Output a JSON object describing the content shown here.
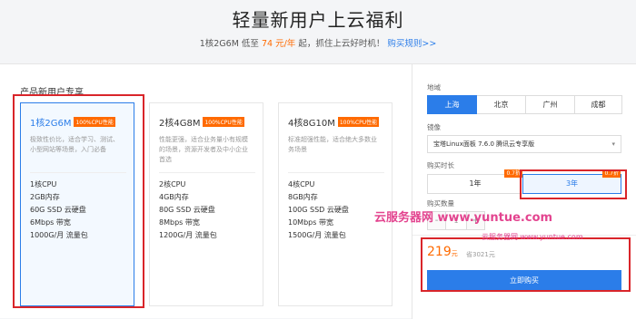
{
  "header": {
    "title": "轻量新用户上云福利",
    "sub_prefix": "1核2G6M 低至",
    "sub_price": "74 元/年",
    "sub_suffix": "起，抓住上云好时机！",
    "rules_link": "购买规则>>"
  },
  "products": {
    "section_title": "产品新用户专享",
    "cards": [
      {
        "name": "1核2G6M",
        "badge": "100%CPU性能",
        "desc": "极致性价比，适合学习、测试、小型网站等场景，入门必备",
        "specs": [
          "1核CPU",
          "2GB内存",
          "60G SSD 云硬盘",
          "6Mbps 带宽",
          "1000G/月 流量包"
        ]
      },
      {
        "name": "2核4G8M",
        "badge": "100%CPU性能",
        "desc": "性能更强，适合业务量小有规模的场景，资源开发者及中小企业首选",
        "specs": [
          "2核CPU",
          "4GB内存",
          "80G SSD 云硬盘",
          "8Mbps 带宽",
          "1200G/月 流量包"
        ]
      },
      {
        "name": "4核8G10M",
        "badge": "100%CPU性能",
        "desc": "标准超强性能，适合绝大多数业务场景",
        "specs": [
          "4核CPU",
          "8GB内存",
          "100G SSD 云硬盘",
          "10Mbps 带宽",
          "1500G/月 流量包"
        ]
      }
    ]
  },
  "config": {
    "region_label": "地域",
    "regions": [
      "上海",
      "北京",
      "广州",
      "成都"
    ],
    "image_label": "镜像",
    "image_value": "宝塔Linux面板 7.6.0 腾讯云专享版",
    "duration_label": "购买时长",
    "durations": [
      {
        "label": "1年",
        "discount": "0.7折"
      },
      {
        "label": "3年",
        "discount": "0.7折"
      }
    ],
    "qty_label": "购买数量",
    "qty_minus": "-",
    "qty_value": "1",
    "qty_plus": "+",
    "price": "219",
    "price_unit": "元",
    "orig_price": "省3021元",
    "buy_label": "立即购买"
  },
  "watermark": {
    "text1": "云服务器网 www.yuntue.com",
    "text2": "云服务器网 www.yuntue.com"
  },
  "colors": {
    "accent": "#2b7de9",
    "price": "#ff6a00",
    "highlight": "#d9252a"
  }
}
